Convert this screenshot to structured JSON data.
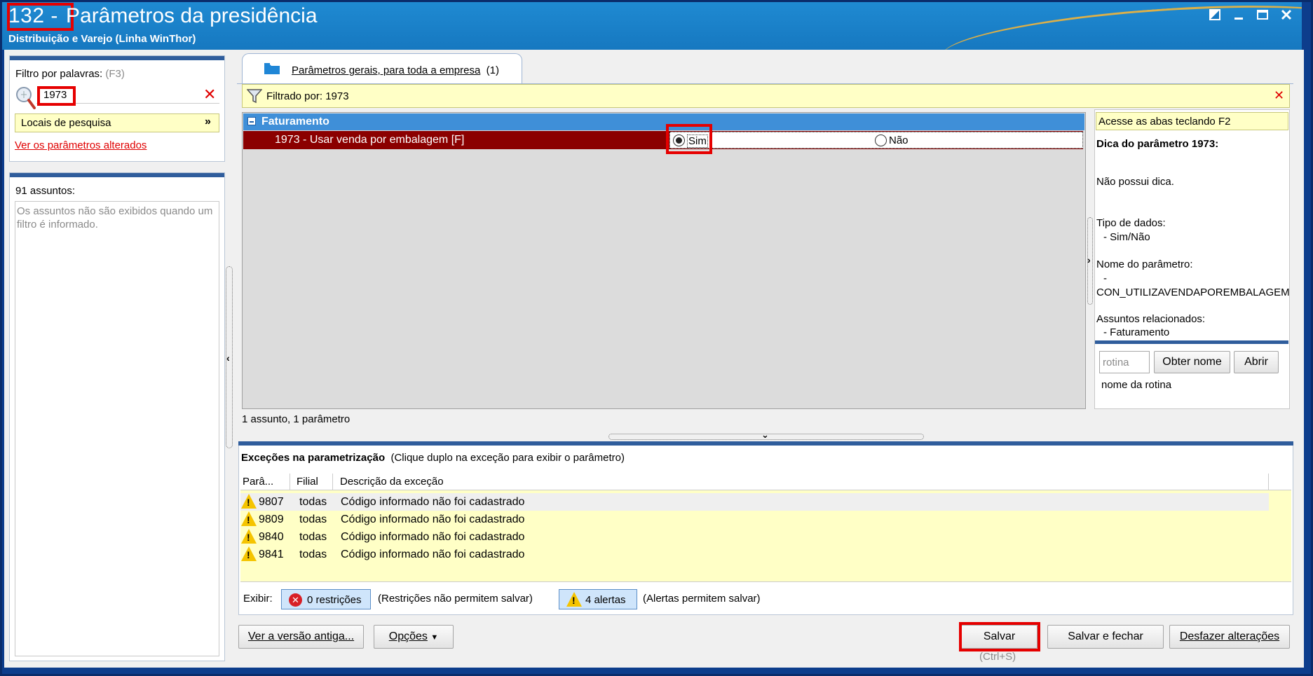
{
  "window": {
    "title_number": "132 -",
    "title": "Parâmetros da presidência",
    "subtitle": "Distribuição e Varejo (Linha WinThor)"
  },
  "left_filter": {
    "label": "Filtro por palavras:",
    "shortcut": "(F3)",
    "search_value": "1973",
    "locations_label": "Locais de pesquisa",
    "changed_link": "Ver os parâmetros alterados"
  },
  "subjects": {
    "count_label": "91 assuntos:",
    "message": "Os assuntos não são exibidos quando um filtro é informado."
  },
  "tabs": [
    {
      "label": "Parâmetros gerais, para toda a empresa",
      "count": "(1)"
    }
  ],
  "filter_bar": {
    "text": "Filtrado por: 1973"
  },
  "grid": {
    "group": "Faturamento",
    "param_label": "1973 - Usar venda por embalagem [F]",
    "option_yes": "Sim",
    "option_no": "Não",
    "selected": "Sim",
    "status": "1 assunto, 1 parâmetro"
  },
  "sidebar": {
    "hint": "Acesse as abas teclando F2",
    "tip_title": "Dica do parâmetro 1973:",
    "tip_text": "Não possui dica.",
    "type_label": "Tipo de dados:",
    "type_value": "- Sim/Não",
    "name_label": "Nome do parâmetro:",
    "name_dash": "-",
    "name_value": "CON_UTILIZAVENDAPOREMBALAGEM",
    "related_label": "Assuntos relacionados:",
    "related_value": "- Faturamento",
    "routine_placeholder": "rotina",
    "get_name_button": "Obter nome",
    "open_button": "Abrir",
    "routine_name": "nome da rotina"
  },
  "exceptions": {
    "title": "Exceções na parametrização",
    "hint": "(Clique duplo na exceção para exibir o parâmetro)",
    "columns": [
      "Parâ...",
      "Filial",
      "Descrição da exceção"
    ],
    "rows": [
      {
        "param": "9807",
        "branch": "todas",
        "description": "Código informado não foi cadastrado"
      },
      {
        "param": "9809",
        "branch": "todas",
        "description": "Código informado não foi cadastrado"
      },
      {
        "param": "9840",
        "branch": "todas",
        "description": "Código informado não foi cadastrado"
      },
      {
        "param": "9841",
        "branch": "todas",
        "description": "Código informado não foi cadastrado"
      }
    ],
    "show_label": "Exibir:",
    "restrictions_button": "0 restrições",
    "restrictions_note": "(Restrições não permitem salvar)",
    "alerts_button": "4 alertas",
    "alerts_note": "(Alertas permitem salvar)"
  },
  "footer": {
    "old_version_button": "Ver a versão antiga...",
    "options_button": "Opções",
    "save_button": "Salvar",
    "save_shortcut": "(Ctrl+S)",
    "save_close_button": "Salvar e fechar",
    "undo_button": "Desfazer alterações"
  },
  "colors": {
    "title_bar": "#1678c0",
    "group_header": "#3f8fd8",
    "selected_row": "#8b0000",
    "highlight": "#e60000",
    "filter_yellow": "#ffffc6"
  }
}
